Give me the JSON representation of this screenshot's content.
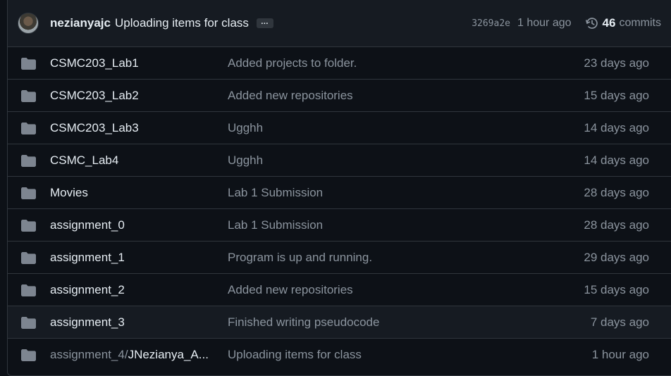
{
  "latest_commit": {
    "author": "nezianyajc",
    "message": "Uploading items for class",
    "ellipsis": "…",
    "sha": "3269a2e",
    "time": "1 hour ago",
    "commits_count": "46",
    "commits_label": "commits"
  },
  "files": [
    {
      "name": "CSMC203_Lab1",
      "message": "Added projects to folder.",
      "time": "23 days ago"
    },
    {
      "name": "CSMC203_Lab2",
      "message": "Added new repositories",
      "time": "15 days ago"
    },
    {
      "name": "CSMC203_Lab3",
      "message": "Ugghh",
      "time": "14 days ago"
    },
    {
      "name": "CSMC_Lab4",
      "message": "Ugghh",
      "time": "14 days ago"
    },
    {
      "name": "Movies",
      "message": "Lab 1 Submission",
      "time": "28 days ago"
    },
    {
      "name": "assignment_0",
      "message": "Lab 1 Submission",
      "time": "28 days ago"
    },
    {
      "name": "assignment_1",
      "message": "Program is up and running.",
      "time": "29 days ago"
    },
    {
      "name": "assignment_2",
      "message": "Added new repositories",
      "time": "15 days ago"
    },
    {
      "name": "assignment_3",
      "message": "Finished writing pseudocode",
      "time": "7 days ago"
    },
    {
      "name_prefix": "assignment_4/",
      "name_suffix": "JNezianya_A...",
      "message": "Uploading items for class",
      "time": "1 hour ago"
    }
  ],
  "icons": {
    "folder": "folder-icon",
    "history": "history-icon"
  },
  "colors": {
    "background": "#0d1117",
    "header": "#161b22",
    "border": "#30363d",
    "muted": "#8b949e",
    "text": "#e6edf3",
    "folder": "#7d8590"
  }
}
